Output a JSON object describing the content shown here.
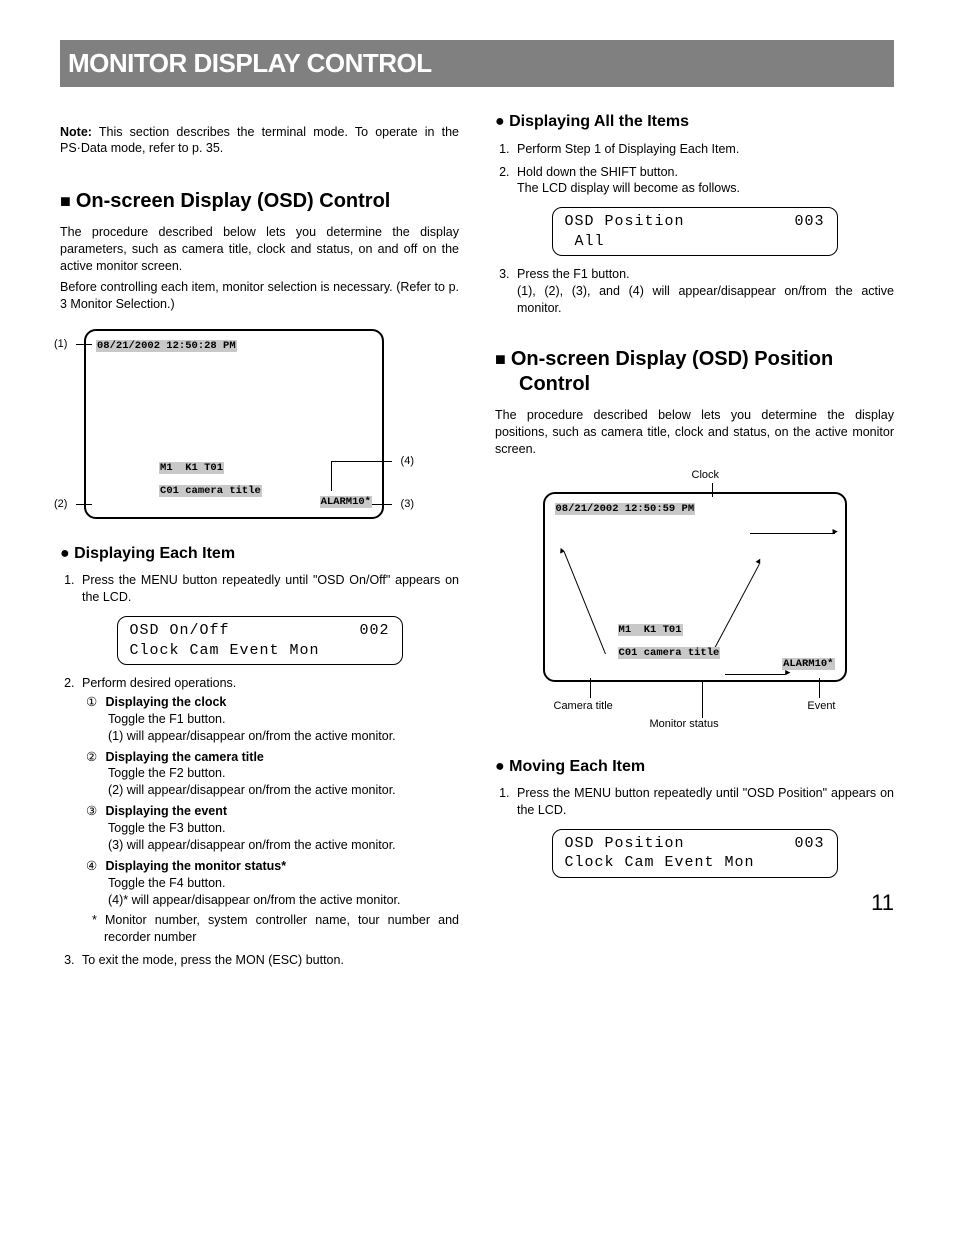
{
  "title": "MONITOR DISPLAY CONTROL",
  "note_label": "Note:",
  "note": "This section describes the terminal mode. To operate in the PS·Data mode, refer to p. 35.",
  "osd_control": {
    "heading": "On-screen Display (OSD) Control",
    "p1": "The procedure described below lets you determine the display parameters, such as camera title, clock and status, on and off on the active monitor screen.",
    "p2": "Before controlling each item, monitor selection is necessary. (Refer to p. 3 Monitor Selection.)"
  },
  "screen1": {
    "datetime": "08/21/2002 12:50:28 PM",
    "line1": "M1  K1 T01",
    "line2a": "C01 camera title",
    "alarm": "ALARM10*",
    "c1": "(1)",
    "c2": "(2)",
    "c3": "(3)",
    "c4": "(4)"
  },
  "each_item": {
    "heading": "Displaying Each Item",
    "step1": "Press the MENU button repeatedly until \"OSD On/Off\" appears on the LCD.",
    "lcd_l1a": "OSD On/Off",
    "lcd_l1b": "002",
    "lcd_l2": "Clock Cam Event Mon",
    "step2": "Perform desired operations.",
    "items": [
      {
        "num": "①",
        "title": "Displaying the clock",
        "l1": "Toggle the F1 button.",
        "l2": "(1) will appear/disappear on/from the active monitor."
      },
      {
        "num": "②",
        "title": "Displaying the camera title",
        "l1": "Toggle the F2 button.",
        "l2": "(2) will appear/disappear on/from the active monitor."
      },
      {
        "num": "③",
        "title": "Displaying the event",
        "l1": "Toggle the F3 button.",
        "l2": "(3) will appear/disappear on/from the active monitor."
      },
      {
        "num": "④",
        "title": "Displaying the monitor status*",
        "l1": "Toggle the F4 button.",
        "l2": "(4)* will appear/disappear on/from the active monitor."
      }
    ],
    "footnote": "* Monitor number, system controller name, tour number and recorder number",
    "step3": "To exit the mode, press the MON (ESC) button."
  },
  "all_items": {
    "heading": "Displaying All the Items",
    "step1": "Perform Step 1 of Displaying Each Item.",
    "step2a": "Hold down the SHIFT button.",
    "step2b": "The LCD display will become as follows.",
    "lcd_l1a": "OSD Position",
    "lcd_l1b": "003",
    "lcd_l2": " All",
    "step3a": "Press the F1 button.",
    "step3b": "(1), (2), (3), and (4) will appear/disappear on/from the active monitor."
  },
  "pos_control": {
    "heading": "On-screen Display (OSD) Position Control",
    "p": "The procedure described below lets you determine the display positions, such as camera title, clock and status, on the active monitor screen."
  },
  "screen2": {
    "datetime": "08/21/2002 12:50:59 PM",
    "line1": "M1  K1 T01",
    "line2a": "C01 camera title",
    "alarm": "ALARM10*",
    "lbl_clock": "Clock",
    "lbl_ct": "Camera title",
    "lbl_ev": "Event",
    "lbl_ms": "Monitor status"
  },
  "moving": {
    "heading": "Moving Each Item",
    "step1": "Press the MENU button repeatedly until \"OSD Position\" appears on the LCD.",
    "lcd_l1a": "OSD Position",
    "lcd_l1b": "003",
    "lcd_l2": "Clock Cam Event Mon"
  },
  "page": "11"
}
